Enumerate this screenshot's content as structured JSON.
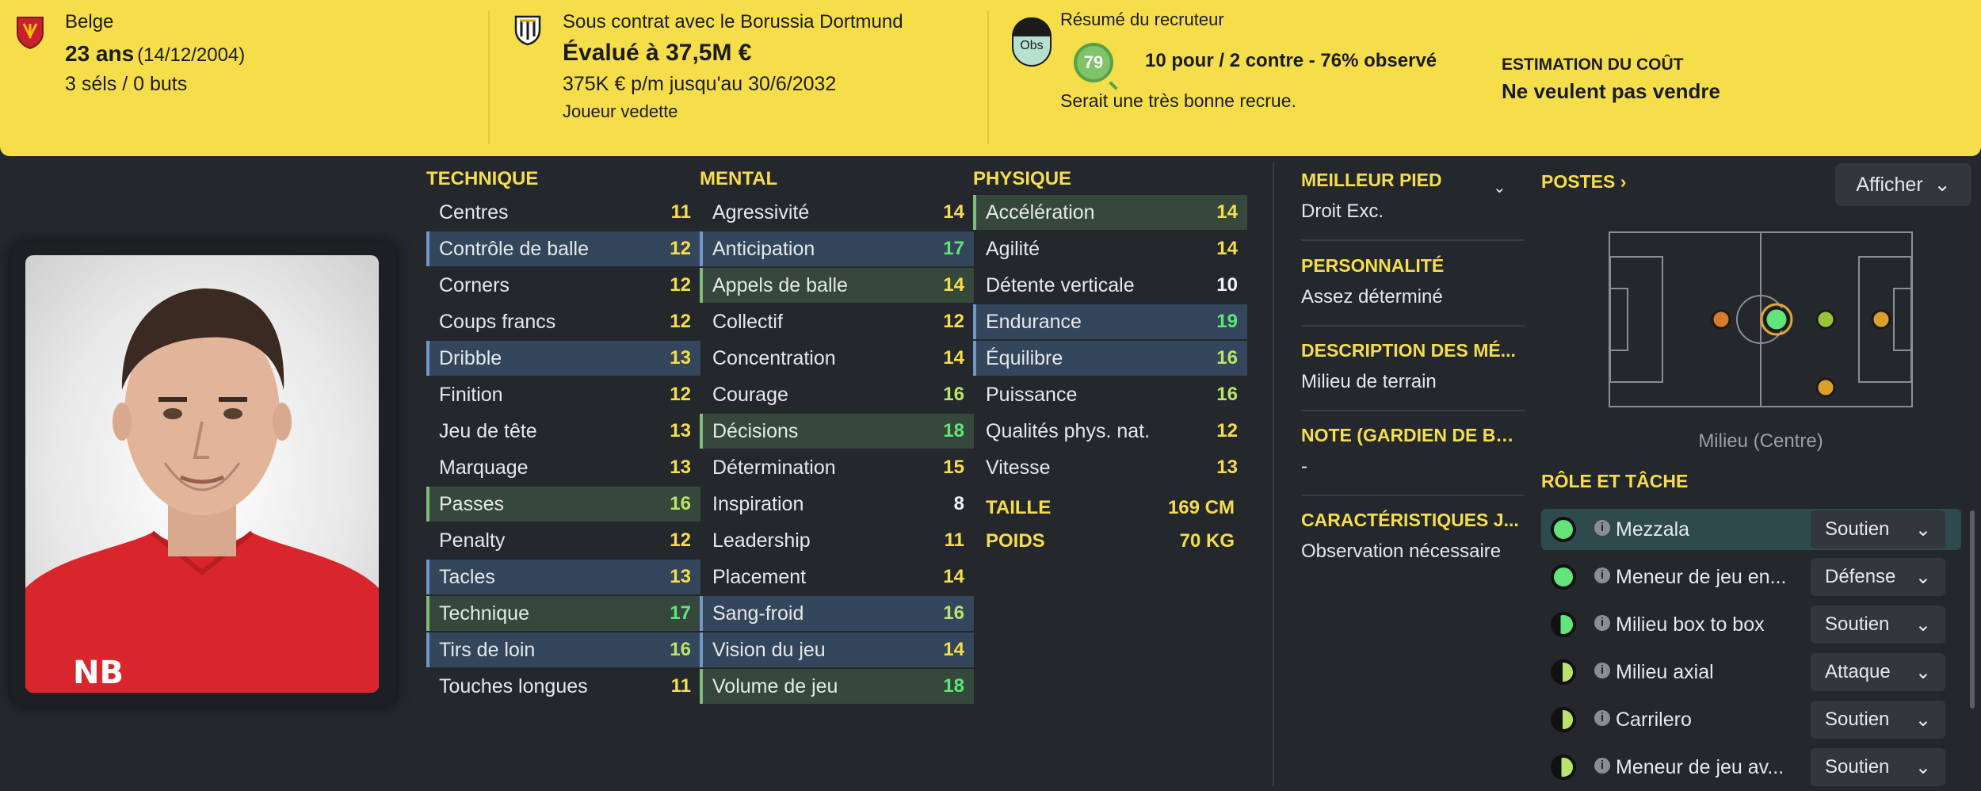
{
  "header": {
    "nationality": "Belge",
    "age": "23 ans",
    "dob": "(14/12/2004)",
    "caps": "3 séls / 0 buts",
    "club_contract": "Sous contrat avec le Borussia Dortmund",
    "value": "Évalué à 37,5M €",
    "wage": "375K € p/m jusqu'au 30/6/2032",
    "squad_status": "Joueur vedette",
    "obs_badge": "Obs",
    "scout_title": "Résumé du recruteur",
    "scout_rating": "79",
    "recommendation_summary": "10 pour / 2 contre - 76% observé",
    "recommendation": "Serait une très bonne recrue.",
    "cost_label": "ESTIMATION DU COÛT",
    "cost_value": "Ne veulent pas vendre"
  },
  "attributes": {
    "technical": {
      "title": "TECHNIQUE",
      "items": [
        {
          "name": "Centres",
          "value": "11"
        },
        {
          "name": "Contrôle de balle",
          "value": "12"
        },
        {
          "name": "Corners",
          "value": "12"
        },
        {
          "name": "Coups francs",
          "value": "12"
        },
        {
          "name": "Dribble",
          "value": "13"
        },
        {
          "name": "Finition",
          "value": "12"
        },
        {
          "name": "Jeu de tête",
          "value": "13"
        },
        {
          "name": "Marquage",
          "value": "13"
        },
        {
          "name": "Passes",
          "value": "16"
        },
        {
          "name": "Penalty",
          "value": "12"
        },
        {
          "name": "Tacles",
          "value": "13"
        },
        {
          "name": "Technique",
          "value": "17"
        },
        {
          "name": "Tirs de loin",
          "value": "16"
        },
        {
          "name": "Touches longues",
          "value": "11"
        }
      ]
    },
    "mental": {
      "title": "MENTAL",
      "items": [
        {
          "name": "Agressivité",
          "value": "14"
        },
        {
          "name": "Anticipation",
          "value": "17"
        },
        {
          "name": "Appels de balle",
          "value": "14"
        },
        {
          "name": "Collectif",
          "value": "12"
        },
        {
          "name": "Concentration",
          "value": "14"
        },
        {
          "name": "Courage",
          "value": "16"
        },
        {
          "name": "Décisions",
          "value": "18"
        },
        {
          "name": "Détermination",
          "value": "15"
        },
        {
          "name": "Inspiration",
          "value": "8"
        },
        {
          "name": "Leadership",
          "value": "11"
        },
        {
          "name": "Placement",
          "value": "14"
        },
        {
          "name": "Sang-froid",
          "value": "16"
        },
        {
          "name": "Vision du jeu",
          "value": "14"
        },
        {
          "name": "Volume de jeu",
          "value": "18"
        }
      ]
    },
    "physical": {
      "title": "PHYSIQUE",
      "items": [
        {
          "name": "Accélération",
          "value": "14"
        },
        {
          "name": "Agilité",
          "value": "14"
        },
        {
          "name": "Détente verticale",
          "value": "10"
        },
        {
          "name": "Endurance",
          "value": "19"
        },
        {
          "name": "Équilibre",
          "value": "16"
        },
        {
          "name": "Puissance",
          "value": "16"
        },
        {
          "name": "Qualités phys. nat.",
          "value": "12"
        },
        {
          "name": "Vitesse",
          "value": "13"
        }
      ],
      "height_label": "TAILLE",
      "height_value": "169 CM",
      "weight_label": "POIDS",
      "weight_value": "70 KG"
    }
  },
  "info": {
    "foot_label": "MEILLEUR PIED",
    "foot_value": "Droit Exc.",
    "personality_label": "PERSONNALITÉ",
    "personality_value": "Assez déterminé",
    "media_label": "DESCRIPTION DES MÉ...",
    "media_value": "Milieu de terrain",
    "gk_label": "NOTE (GARDIEN DE BUT)",
    "gk_value": "-",
    "traits_label": "CARACTÉRISTIQUES J...",
    "traits_value": "Observation nécessaire"
  },
  "positions": {
    "title": "POSTES",
    "show_button": "Afficher",
    "caption": "Milieu (Centre)"
  },
  "roles": {
    "title": "RÔLE ET TÂCHE",
    "items": [
      {
        "name": "Mezzala",
        "duty": "Soutien"
      },
      {
        "name": "Meneur de jeu en...",
        "duty": "Défense"
      },
      {
        "name": "Milieu box to box",
        "duty": "Soutien"
      },
      {
        "name": "Milieu axial",
        "duty": "Attaque"
      },
      {
        "name": "Carrilero",
        "duty": "Soutien"
      },
      {
        "name": "Meneur de jeu av...",
        "duty": "Soutien"
      }
    ]
  },
  "colors": {
    "header_bg": "#f5de4a",
    "page_bg": "#24272c",
    "accent_yellow": "#f5de4a",
    "value_green": "#63e47a",
    "value_lightgreen": "#b9e36a",
    "highlight_blue": "#33465b",
    "highlight_green": "#35483b"
  }
}
